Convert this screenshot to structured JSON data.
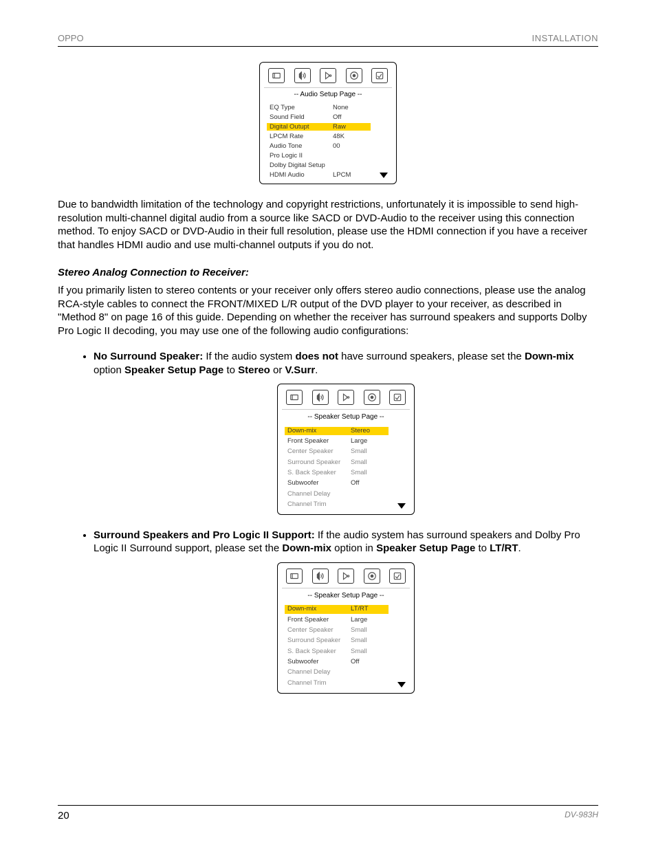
{
  "header": {
    "brand": "OPPO",
    "title": "INSTALLATION"
  },
  "panel1": {
    "title": "-- Audio Setup Page --",
    "rows": [
      {
        "label": "EQ Type",
        "value": "None",
        "hl": false,
        "grey": false
      },
      {
        "label": "Sound Field",
        "value": "Off",
        "hl": false,
        "grey": false
      },
      {
        "label": "Digital Outupt",
        "value": "Raw",
        "hl": true,
        "grey": false
      },
      {
        "label": "LPCM Rate",
        "value": "48K",
        "hl": false,
        "grey": false
      },
      {
        "label": "Audio Tone",
        "value": "00",
        "hl": false,
        "grey": false
      },
      {
        "label": "Pro Logic II",
        "value": "",
        "hl": false,
        "grey": false
      },
      {
        "label": "Dolby Digital Setup",
        "value": "",
        "hl": false,
        "grey": false
      },
      {
        "label": "HDMI Audio",
        "value": "LPCM",
        "hl": false,
        "grey": false
      }
    ]
  },
  "para_bandwidth": "Due to bandwidth limitation of the technology and copyright restrictions, unfortunately it is impossible to send high-resolution multi-channel digital audio from a source like SACD or DVD-Audio to the receiver using this connection method.  To enjoy SACD or DVD-Audio in their full resolution, please use the HDMI connection if you have a receiver that handles HDMI audio and use multi-channel outputs if you do not.",
  "section_title": "Stereo Analog Connection to Receiver:",
  "para_stereo": "If you primarily listen to stereo contents or your receiver only offers stereo audio connections, please use the analog RCA-style cables to connect the FRONT/MIXED L/R output of the DVD player to your receiver, as described in \"Method 8\" on page 16 of this guide.  Depending on whether the receiver has surround speakers and supports Dolby Pro Logic II decoding, you may use one of the following audio configurations:",
  "bullet1": {
    "prefix": "No Surround Speaker:",
    "t1": " If the audio system ",
    "b1": "does not",
    "t2": " have surround speakers, please set the ",
    "b2": "Down-mix",
    "t3": " option ",
    "b3": "Speaker Setup Page",
    "t4": " to ",
    "b4": "Stereo",
    "t5": " or ",
    "b5": "V.Surr",
    "t6": "."
  },
  "panel2": {
    "title": "-- Speaker Setup Page --",
    "rows": [
      {
        "label": "Down-mix",
        "value": "Stereo",
        "hl": true,
        "grey": false
      },
      {
        "label": "Front Speaker",
        "value": "Large",
        "hl": false,
        "grey": false
      },
      {
        "label": "Center Speaker",
        "value": "Small",
        "hl": false,
        "grey": true
      },
      {
        "label": "Surround Speaker",
        "value": "Small",
        "hl": false,
        "grey": true
      },
      {
        "label": "S. Back Speaker",
        "value": "Small",
        "hl": false,
        "grey": true
      },
      {
        "label": "Subwoofer",
        "value": "Off",
        "hl": false,
        "grey": false
      },
      {
        "label": "Channel Delay",
        "value": "",
        "hl": false,
        "grey": true
      },
      {
        "label": "Channel Trim",
        "value": "",
        "hl": false,
        "grey": true
      }
    ]
  },
  "bullet2": {
    "prefix": "Surround Speakers and Pro Logic II Support:",
    "t1": " If the audio system has surround speakers and Dolby Pro Logic II Surround support, please set the ",
    "b1": "Down-mix",
    "t2": " option in ",
    "b2": "Speaker Setup Page",
    "t3": " to ",
    "b3": "LT/RT",
    "t4": "."
  },
  "panel3": {
    "title": "-- Speaker Setup Page --",
    "rows": [
      {
        "label": "Down-mix",
        "value": "LT/RT",
        "hl": true,
        "grey": false
      },
      {
        "label": "Front Speaker",
        "value": "Large",
        "hl": false,
        "grey": false
      },
      {
        "label": "Center Speaker",
        "value": "Small",
        "hl": false,
        "grey": true
      },
      {
        "label": "Surround Speaker",
        "value": "Small",
        "hl": false,
        "grey": true
      },
      {
        "label": "S. Back Speaker",
        "value": "Small",
        "hl": false,
        "grey": true
      },
      {
        "label": "Subwoofer",
        "value": "Off",
        "hl": false,
        "grey": false
      },
      {
        "label": "Channel Delay",
        "value": "",
        "hl": false,
        "grey": true
      },
      {
        "label": "Channel Trim",
        "value": "",
        "hl": false,
        "grey": true
      }
    ]
  },
  "footer": {
    "page": "20",
    "model": "DV-983H"
  }
}
